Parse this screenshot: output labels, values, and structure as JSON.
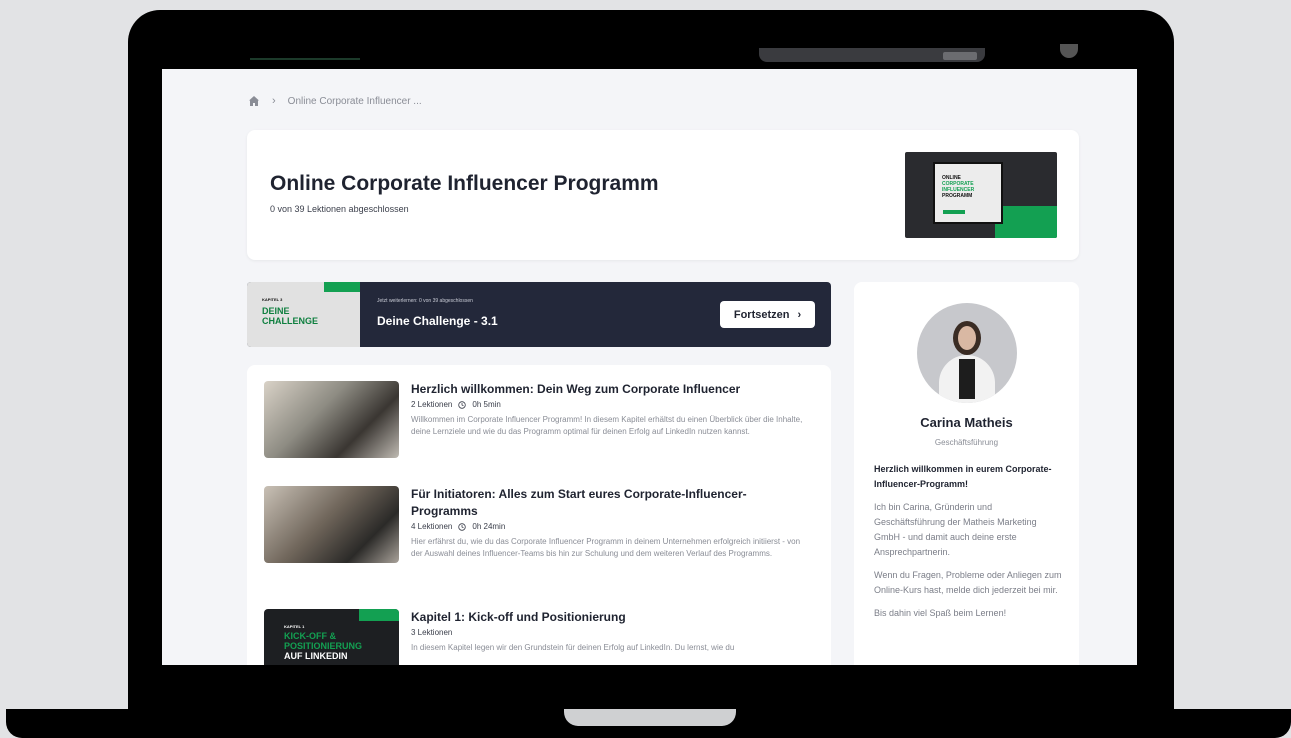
{
  "breadcrumb": {
    "current": "Online Corporate Influencer ..."
  },
  "course": {
    "title": "Online Corporate Influencer Programm",
    "progress": "0 von 39 Lektionen abgeschlossen",
    "thumb_lines": [
      "ONLINE",
      "CORPORATE",
      "INFLUENCER",
      "PROGRAMM"
    ]
  },
  "continue": {
    "thumb_kicker": "KAPITEL 3",
    "thumb_line1": "DEINE",
    "thumb_line2": "CHALLENGE",
    "meta": "Jetzt weiterlernen: 0 von 39 abgeschlossen",
    "title": "Deine Challenge - 3.1",
    "button": "Fortsetzen"
  },
  "lessons": [
    {
      "title": "Herzlich willkommen: Dein Weg zum Corporate Influencer",
      "count": "2 Lektionen",
      "duration": "0h 5min",
      "desc": "Willkommen im Corporate Influencer Programm! In diesem Kapitel erhältst du einen Überblick über die Inhalte, deine Lernziele und wie du das Programm optimal für deinen Erfolg auf LinkedIn nutzen kannst."
    },
    {
      "title": "Für Initiatoren: Alles zum Start eures Corporate-Influencer-Programms",
      "count": "4 Lektionen",
      "duration": "0h 24min",
      "desc": "Hier erfährst du, wie du das Corporate Influencer Programm in deinem Unternehmen erfolgreich initiierst - von der Auswahl deines Influencer-Teams bis hin zur Schulung und dem weiteren Verlauf des Programms."
    },
    {
      "title": "Kapitel 1: Kick-off und Positionierung",
      "count": "3 Lektionen",
      "desc": "In diesem Kapitel legen wir den Grundstein für deinen Erfolg auf LinkedIn. Du lernst, wie du",
      "thumb_kicker": "KAPITEL 1",
      "thumb_line1": "KICK-OFF &",
      "thumb_line2": "POSITIONIERUNG",
      "thumb_line3": "AUF LINKEDIN"
    }
  ],
  "instructor": {
    "name": "Carina Matheis",
    "role": "Geschäftsführung",
    "greeting": "Herzlich willkommen in eurem Corporate-Influencer-Programm!",
    "p1": "Ich bin Carina, Gründerin und Geschäftsführung der Matheis Marketing GmbH - und damit auch deine erste Ansprechpartnerin.",
    "p2": "Wenn du Fragen, Probleme oder Anliegen zum Online-Kurs hast, melde dich jederzeit bei mir.",
    "p3": "Bis dahin viel Spaß beim Lernen!"
  },
  "colors": {
    "accent": "#13a052",
    "banner": "#23283a",
    "page": "#f4f5f8"
  }
}
